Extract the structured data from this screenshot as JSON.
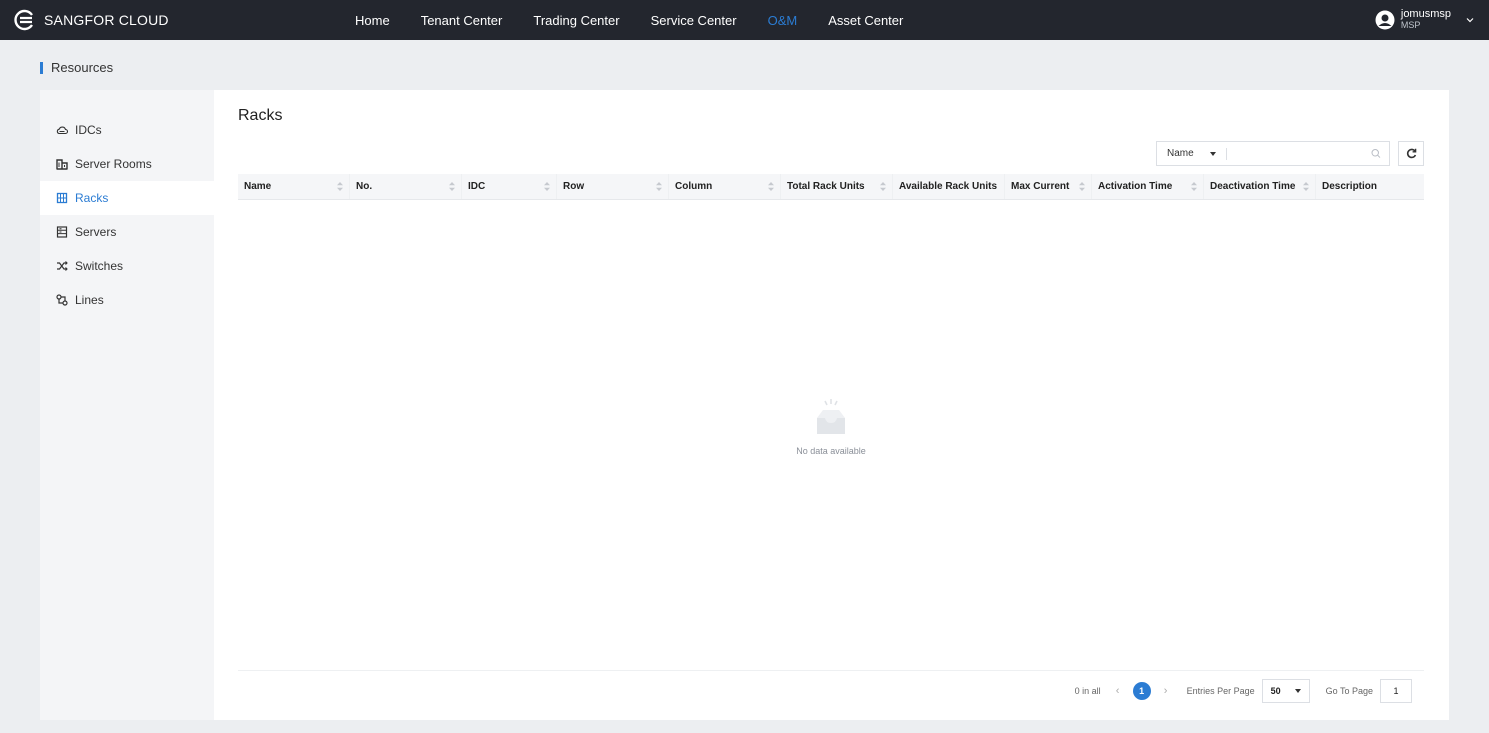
{
  "brand": {
    "name": "SANGFOR CLOUD"
  },
  "nav": [
    {
      "label": "Home",
      "active": false
    },
    {
      "label": "Tenant Center",
      "active": false
    },
    {
      "label": "Trading Center",
      "active": false
    },
    {
      "label": "Service Center",
      "active": false
    },
    {
      "label": "O&M",
      "active": true
    },
    {
      "label": "Asset Center",
      "active": false
    }
  ],
  "user": {
    "name": "jomusmsp",
    "role": "MSP"
  },
  "page": {
    "title": "Resources"
  },
  "sidebar": {
    "items": [
      {
        "label": "IDCs",
        "icon": "cloud-icon"
      },
      {
        "label": "Server Rooms",
        "icon": "building-icon"
      },
      {
        "label": "Racks",
        "icon": "rack-icon",
        "active": true
      },
      {
        "label": "Servers",
        "icon": "server-icon"
      },
      {
        "label": "Switches",
        "icon": "shuffle-icon"
      },
      {
        "label": "Lines",
        "icon": "link-icon"
      }
    ]
  },
  "main": {
    "title": "Racks",
    "search": {
      "field": "Name",
      "value": ""
    },
    "table": {
      "columns": [
        "Name",
        "No.",
        "IDC",
        "Row",
        "Column",
        "Total Rack Units",
        "Available Rack Units",
        "Max Current",
        "Activation Time",
        "Deactivation Time",
        "Description"
      ],
      "rows": []
    },
    "empty_text": "No data available",
    "pagination": {
      "total_text": "0 in all",
      "current_page": "1",
      "entries_label": "Entries Per Page",
      "page_size": "50",
      "goto_label": "Go To Page",
      "goto_value": "1"
    }
  },
  "colors": {
    "accent": "#2b7cd3",
    "topbar": "#23262e",
    "background": "#eceef1"
  }
}
